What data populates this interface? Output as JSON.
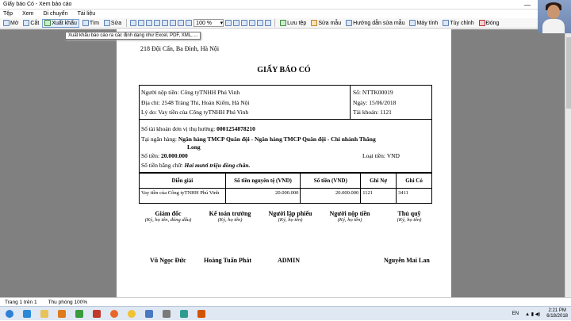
{
  "window": {
    "title": "Giấy báo Có - Xem báo cáo",
    "controls": [
      "—",
      "□",
      "✕"
    ]
  },
  "menu": [
    "Tệp",
    "Xem",
    "Di chuyển",
    "Tài liệu"
  ],
  "toolbar": {
    "new": "Mở",
    "cut": "Cắt",
    "export": "Xuất khẩu",
    "find": "Tìm",
    "edit": "Sửa",
    "zoom": "100 %",
    "rule": "Lưu tệp",
    "sample": "Sửa mẫu",
    "guide": "Hướng dẫn sửa mẫu",
    "print": "Máy tính",
    "customize": "Tùy chỉnh",
    "close": "Đóng"
  },
  "tooltip": "Xuất khẩu báo cáo ra các định dạng như Excel, PDF, XML, ...",
  "doc": {
    "address": "218 Đội Cấn, Ba Đình, Hà Nội",
    "title": "GIẤY BÁO CÓ",
    "payer_label": "Người nộp tiền:",
    "payer": "Công tyTNHH Phú Vinh",
    "addr_label": "Địa chỉ:",
    "addr": "2548 Tràng Thi, Hoàn Kiếm, Hà Nội",
    "reason_label": "Lý do:",
    "reason": "Vay tiền của Công tyTNHH Phú Vinh",
    "no_label": "Số:",
    "no": "NTTK00019",
    "date_label": "Ngày:",
    "date": "15/06/2018",
    "acct_label": "Tài khoản:",
    "acct": "1121",
    "recv_acct_label": "Số tài khoản đơn vị thụ hưởng:",
    "recv_acct": "0001254878210",
    "bank_label": "Tại ngân hàng:",
    "bank_line1": "Ngân hàng TMCP Quân đội  - Ngân hàng TMCP Quân đội - Chi nhánh Thăng",
    "bank_line2": "Long",
    "amount_label": "Số tiền:",
    "amount": "20.000.000",
    "currency_label": "Loại tiền:",
    "currency": "VND",
    "words_label": "Số tiền bằng chữ:",
    "words": "Hai mươi triệu đồng chẵn.",
    "table": {
      "headers": [
        "Diễn giải",
        "Số tiền nguyên tệ (VND)",
        "Số tiền (VND)",
        "Ghi Nợ",
        "Ghi Có"
      ],
      "rows": [
        [
          "Vay tiền của Công tyTNHH Phú Vinh",
          "20.000.000",
          "20.000.000",
          "1121",
          "3411"
        ]
      ]
    },
    "sign": [
      {
        "h": "Giám đốc",
        "s": "(Ký, họ tên, đóng dấu)"
      },
      {
        "h": "Kế toán trưởng",
        "s": "(Ký, họ tên)"
      },
      {
        "h": "Người lập phiếu",
        "s": "(Ký, họ tên)"
      },
      {
        "h": "Người nộp tiền",
        "s": "(Ký, họ tên)"
      },
      {
        "h": "Thủ quỹ",
        "s": "(Ký, họ tên)"
      }
    ],
    "names": [
      "Vũ Ngọc Đức",
      "Hoàng Tuấn Phát",
      "ADMIN",
      "Nguyễn Mai Lan"
    ]
  },
  "status": {
    "page": "Trang 1 trên 1",
    "zoom": "Thu phóng 100%"
  },
  "tray": {
    "lang": "EN",
    "time": "2:21 PM",
    "date": "6/18/2018"
  }
}
